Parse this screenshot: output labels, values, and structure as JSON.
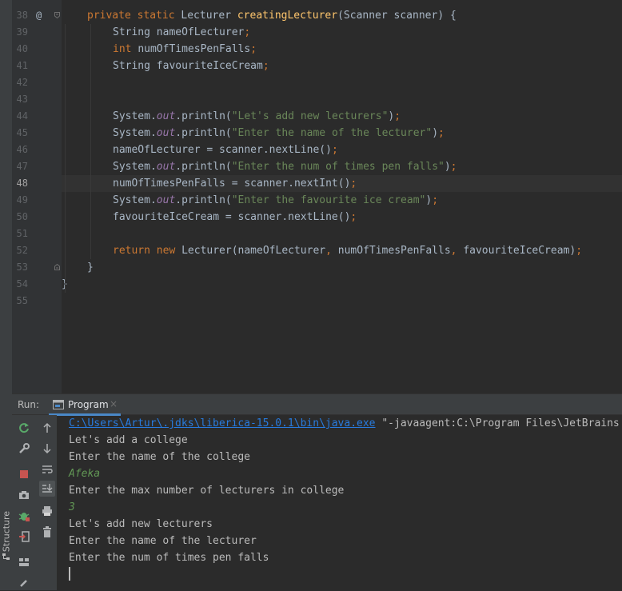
{
  "editor": {
    "lines": [
      {
        "num": "38",
        "gutter_mark": "@",
        "indent": 1,
        "tokens": [
          {
            "t": "kw",
            "v": "private static "
          },
          {
            "t": "plain",
            "v": "Lecturer "
          },
          {
            "t": "fn",
            "v": "creatingLecturer"
          },
          {
            "t": "plain",
            "v": "(Scanner scanner) {"
          }
        ]
      },
      {
        "num": "39",
        "indent": 2,
        "tokens": [
          {
            "t": "plain",
            "v": "String nameOfLecturer"
          },
          {
            "t": "kw",
            "v": ";"
          }
        ]
      },
      {
        "num": "40",
        "indent": 2,
        "tokens": [
          {
            "t": "kw",
            "v": "int "
          },
          {
            "t": "plain",
            "v": "numOfTimesPenFalls"
          },
          {
            "t": "kw",
            "v": ";"
          }
        ]
      },
      {
        "num": "41",
        "indent": 2,
        "tokens": [
          {
            "t": "plain",
            "v": "String favouriteIceCream"
          },
          {
            "t": "kw",
            "v": ";"
          }
        ]
      },
      {
        "num": "42",
        "indent": 0,
        "tokens": []
      },
      {
        "num": "43",
        "indent": 0,
        "tokens": []
      },
      {
        "num": "44",
        "indent": 2,
        "tokens": [
          {
            "t": "plain",
            "v": "System."
          },
          {
            "t": "st",
            "v": "out"
          },
          {
            "t": "plain",
            "v": ".println("
          },
          {
            "t": "str",
            "v": "\"Let's add new lecturers\""
          },
          {
            "t": "plain",
            "v": ")"
          },
          {
            "t": "kw",
            "v": ";"
          }
        ]
      },
      {
        "num": "45",
        "indent": 2,
        "tokens": [
          {
            "t": "plain",
            "v": "System."
          },
          {
            "t": "st",
            "v": "out"
          },
          {
            "t": "plain",
            "v": ".println("
          },
          {
            "t": "str",
            "v": "\"Enter the name of the lecturer\""
          },
          {
            "t": "plain",
            "v": ")"
          },
          {
            "t": "kw",
            "v": ";"
          }
        ]
      },
      {
        "num": "46",
        "indent": 2,
        "tokens": [
          {
            "t": "plain",
            "v": "nameOfLecturer = scanner.nextLine()"
          },
          {
            "t": "kw",
            "v": ";"
          }
        ]
      },
      {
        "num": "47",
        "indent": 2,
        "tokens": [
          {
            "t": "plain",
            "v": "System."
          },
          {
            "t": "st",
            "v": "out"
          },
          {
            "t": "plain",
            "v": ".println("
          },
          {
            "t": "str",
            "v": "\"Enter the num of times pen falls\""
          },
          {
            "t": "plain",
            "v": ")"
          },
          {
            "t": "kw",
            "v": ";"
          }
        ]
      },
      {
        "num": "48",
        "indent": 2,
        "current": true,
        "tokens": [
          {
            "t": "plain",
            "v": "numOfTimesPenFalls = scanner.nextInt()"
          },
          {
            "t": "kw",
            "v": ";"
          }
        ]
      },
      {
        "num": "49",
        "indent": 2,
        "tokens": [
          {
            "t": "plain",
            "v": "System."
          },
          {
            "t": "st",
            "v": "out"
          },
          {
            "t": "plain",
            "v": ".println("
          },
          {
            "t": "str",
            "v": "\"Enter the favourite ice cream\""
          },
          {
            "t": "plain",
            "v": ")"
          },
          {
            "t": "kw",
            "v": ";"
          }
        ]
      },
      {
        "num": "50",
        "indent": 2,
        "tokens": [
          {
            "t": "plain",
            "v": "favouriteIceCream = scanner.nextLine()"
          },
          {
            "t": "kw",
            "v": ";"
          }
        ]
      },
      {
        "num": "51",
        "indent": 0,
        "tokens": []
      },
      {
        "num": "52",
        "indent": 2,
        "tokens": [
          {
            "t": "kw",
            "v": "return new "
          },
          {
            "t": "plain",
            "v": "Lecturer(nameOfLecturer"
          },
          {
            "t": "kw",
            "v": ", "
          },
          {
            "t": "plain",
            "v": "numOfTimesPenFalls"
          },
          {
            "t": "kw",
            "v": ", "
          },
          {
            "t": "plain",
            "v": "favouriteIceCream)"
          },
          {
            "t": "kw",
            "v": ";"
          }
        ]
      },
      {
        "num": "53",
        "indent": 1,
        "tokens": [
          {
            "t": "plain",
            "v": "}"
          }
        ]
      },
      {
        "num": "54",
        "indent": 0,
        "tokens": [
          {
            "t": "plain",
            "v": "}"
          }
        ]
      },
      {
        "num": "55",
        "indent": 0,
        "tokens": []
      }
    ]
  },
  "run": {
    "title": "Run:",
    "tab_label": "Program",
    "tab_close": "×",
    "console": {
      "path_link": "C:\\Users\\Artur\\.jdks\\liberica-15.0.1\\bin\\java.exe",
      "path_args": " \"-javaagent:C:\\Program Files\\JetBrains",
      "lines": [
        {
          "text": "Let's add a college",
          "input": false
        },
        {
          "text": "Enter the name of the college",
          "input": false
        },
        {
          "text": "Afeka",
          "input": true
        },
        {
          "text": "Enter the max number of lecturers in college",
          "input": false
        },
        {
          "text": "3",
          "input": true
        },
        {
          "text": "Let's add new lecturers",
          "input": false
        },
        {
          "text": "Enter the name of the lecturer",
          "input": false
        },
        {
          "text": "Enter the num of times pen falls",
          "input": false
        }
      ]
    },
    "toolbar_icons": [
      "rerun-icon",
      "up-arrow-icon",
      "wrench-icon",
      "down-arrow-icon",
      "soft-wrap-icon",
      "stop-icon",
      "scroll-to-end-icon",
      "camera-icon",
      "print-icon",
      "debug-bug-icon",
      "trash-icon",
      "login-icon",
      "layout-icon",
      "pin-icon"
    ]
  },
  "left_strip": {
    "structure_label": "Structure"
  },
  "colors": {
    "keyword": "#cc7832",
    "function": "#ffc66d",
    "string": "#6a8759",
    "static_field": "#9876aa",
    "link": "#287bde",
    "user_input": "#629755",
    "rerun_green": "#59a869",
    "stop_red": "#c75450"
  }
}
